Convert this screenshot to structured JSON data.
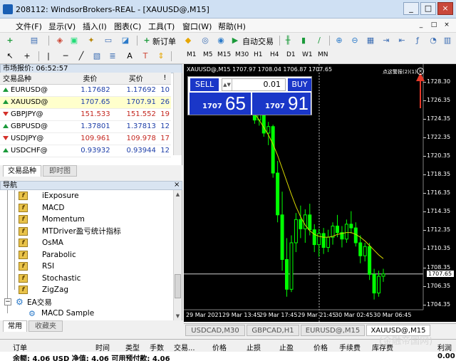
{
  "window": {
    "title": "208112: WindsorBrokers-REAL - [XAUUSD@,M15]",
    "minimize_label": "_",
    "restore_label": "□",
    "close_label": "×"
  },
  "menu": {
    "items": [
      "文件(F)",
      "显示(V)",
      "插入(I)",
      "图表(C)",
      "工具(T)",
      "窗口(W)",
      "帮助(H)"
    ],
    "mdi_minimize": "_",
    "mdi_restore": "□",
    "mdi_close": "×"
  },
  "toolbar": {
    "new_order_label": "新订单",
    "autotrade_label": "自动交易",
    "timeframes": [
      "M1",
      "M5",
      "M15",
      "M30",
      "H1",
      "H4",
      "D1",
      "W1",
      "MN"
    ]
  },
  "market_watch": {
    "header": "市场报价: 06:52:57",
    "columns": [
      "交易品种",
      "卖价",
      "买价",
      "!"
    ],
    "rows": [
      {
        "symbol": "EURUSD@",
        "bid": "1.17682",
        "ask": "1.17692",
        "spread": "10",
        "dir": "up",
        "color": "blue",
        "highlight": false
      },
      {
        "symbol": "XAUUSD@",
        "bid": "1707.65",
        "ask": "1707.91",
        "spread": "26",
        "dir": "up",
        "color": "blue",
        "highlight": true
      },
      {
        "symbol": "GBPJPY@",
        "bid": "151.533",
        "ask": "151.552",
        "spread": "19",
        "dir": "down",
        "color": "red",
        "highlight": false
      },
      {
        "symbol": "GBPUSD@",
        "bid": "1.37801",
        "ask": "1.37813",
        "spread": "12",
        "dir": "up",
        "color": "blue",
        "highlight": false
      },
      {
        "symbol": "USDJPY@",
        "bid": "109.961",
        "ask": "109.978",
        "spread": "17",
        "dir": "down",
        "color": "red",
        "highlight": false
      },
      {
        "symbol": "USDCHF@",
        "bid": "0.93932",
        "ask": "0.93944",
        "spread": "12",
        "dir": "up",
        "color": "blue",
        "highlight": false
      }
    ],
    "tabs": [
      "交易品种",
      "即时图"
    ]
  },
  "navigator": {
    "header": "导航",
    "items": [
      "iExposure",
      "MACD",
      "Momentum",
      "MTDriver盈亏统计指标",
      "OsMA",
      "Parabolic",
      "RSI",
      "Stochastic",
      "ZigZag"
    ],
    "ea_group": "EA交易",
    "ea_items": [
      "MACD Sample"
    ],
    "tabs": [
      "常用",
      "收藏夹"
    ]
  },
  "chart": {
    "title": "XAUUSD@,M15  1707.97 1708.04 1706.87 1707.65",
    "sell_label": "SELL",
    "buy_label": "BUY",
    "lot": "0.01",
    "sell_small": "1707",
    "sell_big": "65",
    "buy_small": "1707",
    "buy_big": "91",
    "alert_text": "点这警报(2)(1)",
    "price_axis": [
      "1728.30",
      "1726.35",
      "1724.35",
      "1722.35",
      "1720.35",
      "1718.35",
      "1716.35",
      "1714.35",
      "1712.35",
      "1710.35",
      "1708.35",
      "1706.35",
      "1704.35"
    ],
    "current_price": "1707.65",
    "time_axis": [
      "29 Mar 2021",
      "29 Mar 13:45",
      "29 Mar 17:45",
      "29 Mar 21:45",
      "30 Mar 02:45",
      "30 Mar 06:45"
    ],
    "colors": {
      "background": "#000000",
      "candles": "#00ff00",
      "moving_average": "#d7d700",
      "grid_line": "#cfcfcf",
      "arrow": "#e53a2a"
    }
  },
  "chart_data": {
    "type": "candlestick",
    "title": "XAUUSD@,M15",
    "ylim": [
      1703.8,
      1729.3
    ],
    "current_price": 1707.65,
    "x_labels": [
      "29 Mar 2021",
      "29 Mar 13:45",
      "29 Mar 17:45",
      "29 Mar 21:45",
      "30 Mar 02:45",
      "30 Mar 06:45"
    ],
    "ohlc": [
      [
        1727.2,
        1728.0,
        1726.2,
        1727.0
      ],
      [
        1727.0,
        1727.6,
        1725.8,
        1726.4
      ],
      [
        1726.4,
        1727.2,
        1725.0,
        1725.6
      ],
      [
        1725.6,
        1726.0,
        1723.8,
        1724.2
      ],
      [
        1724.2,
        1725.8,
        1723.6,
        1725.2
      ],
      [
        1725.2,
        1725.5,
        1722.4,
        1722.8
      ],
      [
        1722.8,
        1724.0,
        1721.5,
        1723.5
      ],
      [
        1723.5,
        1723.7,
        1718.0,
        1718.5
      ],
      [
        1718.5,
        1719.8,
        1713.2,
        1714.0
      ],
      [
        1714.0,
        1716.5,
        1708.0,
        1709.2
      ],
      [
        1709.2,
        1711.5,
        1705.2,
        1706.0
      ],
      [
        1706.0,
        1711.8,
        1705.7,
        1711.0
      ],
      [
        1711.0,
        1714.2,
        1710.0,
        1713.5
      ],
      [
        1713.5,
        1715.0,
        1711.5,
        1712.5
      ],
      [
        1712.5,
        1714.6,
        1711.0,
        1714.0
      ],
      [
        1714.0,
        1715.2,
        1711.8,
        1712.4
      ],
      [
        1712.4,
        1713.0,
        1710.0,
        1710.8
      ],
      [
        1710.8,
        1712.5,
        1709.5,
        1712.0
      ],
      [
        1712.0,
        1712.6,
        1709.8,
        1710.5
      ],
      [
        1710.5,
        1712.4,
        1710.0,
        1711.6
      ],
      [
        1711.6,
        1713.2,
        1710.8,
        1712.8
      ],
      [
        1712.8,
        1714.0,
        1711.6,
        1712.1
      ],
      [
        1712.1,
        1712.8,
        1710.5,
        1711.4
      ],
      [
        1711.4,
        1713.5,
        1711.0,
        1713.0
      ],
      [
        1713.0,
        1714.4,
        1712.0,
        1712.6
      ],
      [
        1712.6,
        1713.2,
        1710.6,
        1711.0
      ],
      [
        1711.0,
        1711.8,
        1708.8,
        1709.6
      ],
      [
        1709.6,
        1711.0,
        1709.0,
        1710.6
      ],
      [
        1710.6,
        1711.0,
        1707.0,
        1707.6
      ],
      [
        1707.6,
        1708.2,
        1704.9,
        1705.6
      ],
      [
        1705.6,
        1708.0,
        1705.2,
        1707.4
      ],
      [
        1707.4,
        1708.2,
        1706.8,
        1707.65
      ]
    ],
    "ma": [
      1727.0,
      1726.3,
      1725.6,
      1724.9,
      1724.2,
      1723.4,
      1722.6,
      1721.6,
      1720.4,
      1719.0,
      1717.6,
      1716.2,
      1714.9,
      1713.8,
      1712.9,
      1712.3,
      1711.9,
      1711.7,
      1711.6,
      1711.6,
      1711.7,
      1711.9,
      1712.0,
      1712.1,
      1712.1,
      1711.9,
      1711.6,
      1711.2,
      1710.7,
      1710.2,
      1709.7,
      1709.3
    ]
  },
  "chart_tabs": [
    "USDCAD,M30",
    "GBPCAD,H1",
    "EURUSD@,M15",
    "XAUUSD@,M15"
  ],
  "terminal": {
    "columns": [
      "订单",
      "时间",
      "类型",
      "手数",
      "交易...",
      "价格",
      "止损",
      "止盈",
      "价格",
      "手续费",
      "库存费",
      "利润"
    ],
    "balance_row": "余额: 4.06 USD  净值: 4.06  可用预付款: 4.06",
    "profit_value": "0.00"
  },
  "watermark": "(金融帝国网)"
}
